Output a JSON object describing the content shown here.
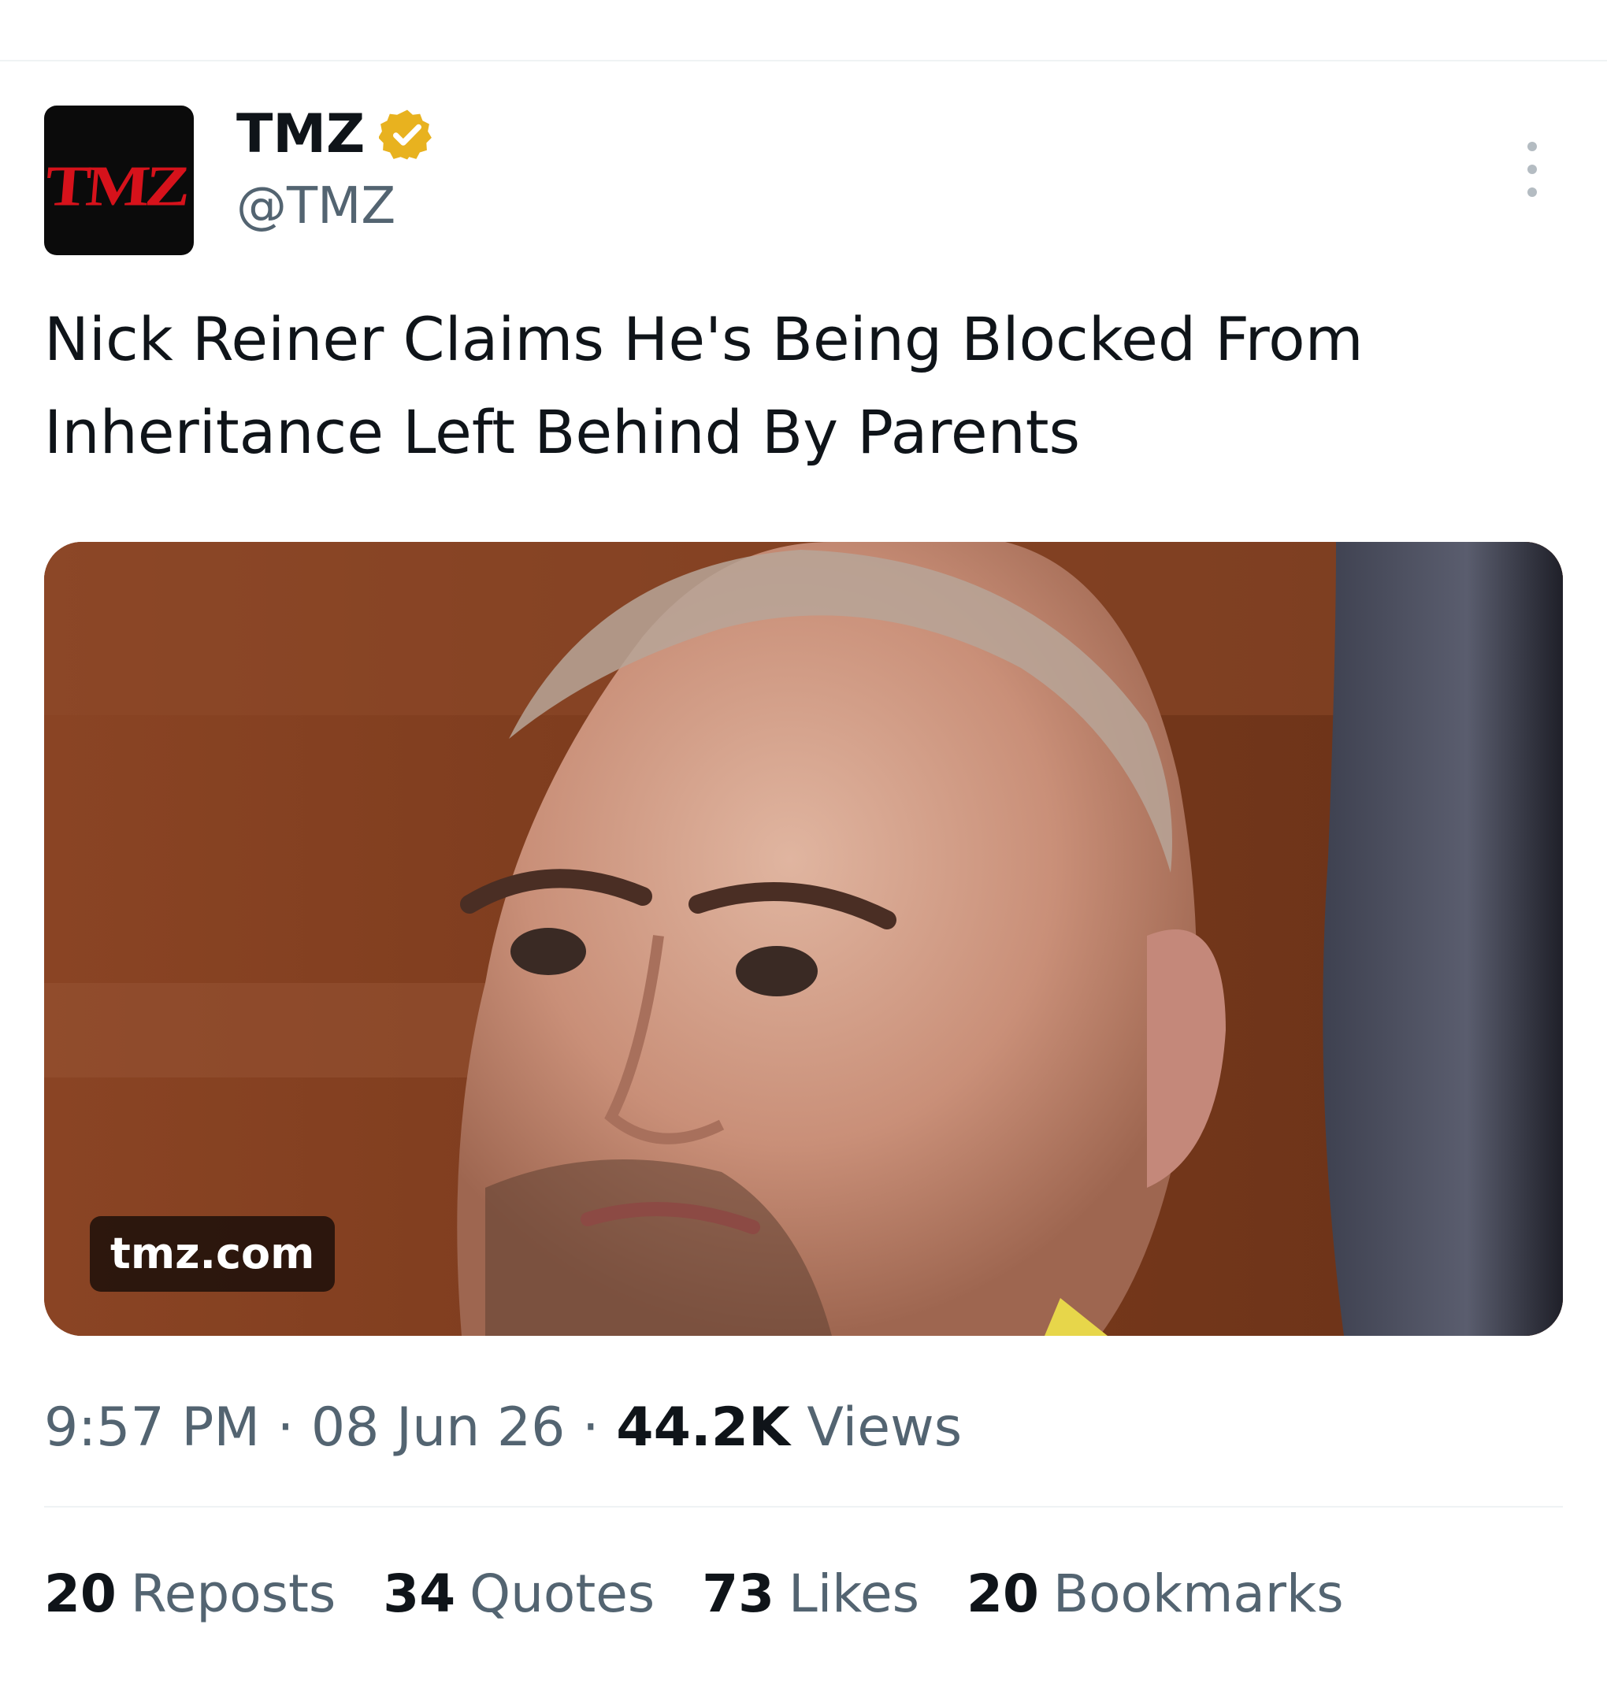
{
  "tweet": {
    "author": {
      "display_name": "TMZ",
      "handle": "@TMZ",
      "avatar_logo": "TMZ",
      "verified_badge": "verified-icon",
      "verified_color": "#e8b21f"
    },
    "text": "Nick Reiner Claims He's Being Blocked From Inheritance Left Behind By Parents",
    "media": {
      "domain": "tmz.com"
    },
    "meta": {
      "time": "9:57 PM",
      "separator": "·",
      "date": "08 Jun 26",
      "views_count": "44.2K",
      "views_label": "Views"
    },
    "stats": [
      {
        "count": "20",
        "label": "Reposts"
      },
      {
        "count": "34",
        "label": "Quotes"
      },
      {
        "count": "73",
        "label": "Likes"
      },
      {
        "count": "20",
        "label": "Bookmarks"
      }
    ]
  },
  "icons": {
    "more": "more-vertical-icon"
  }
}
